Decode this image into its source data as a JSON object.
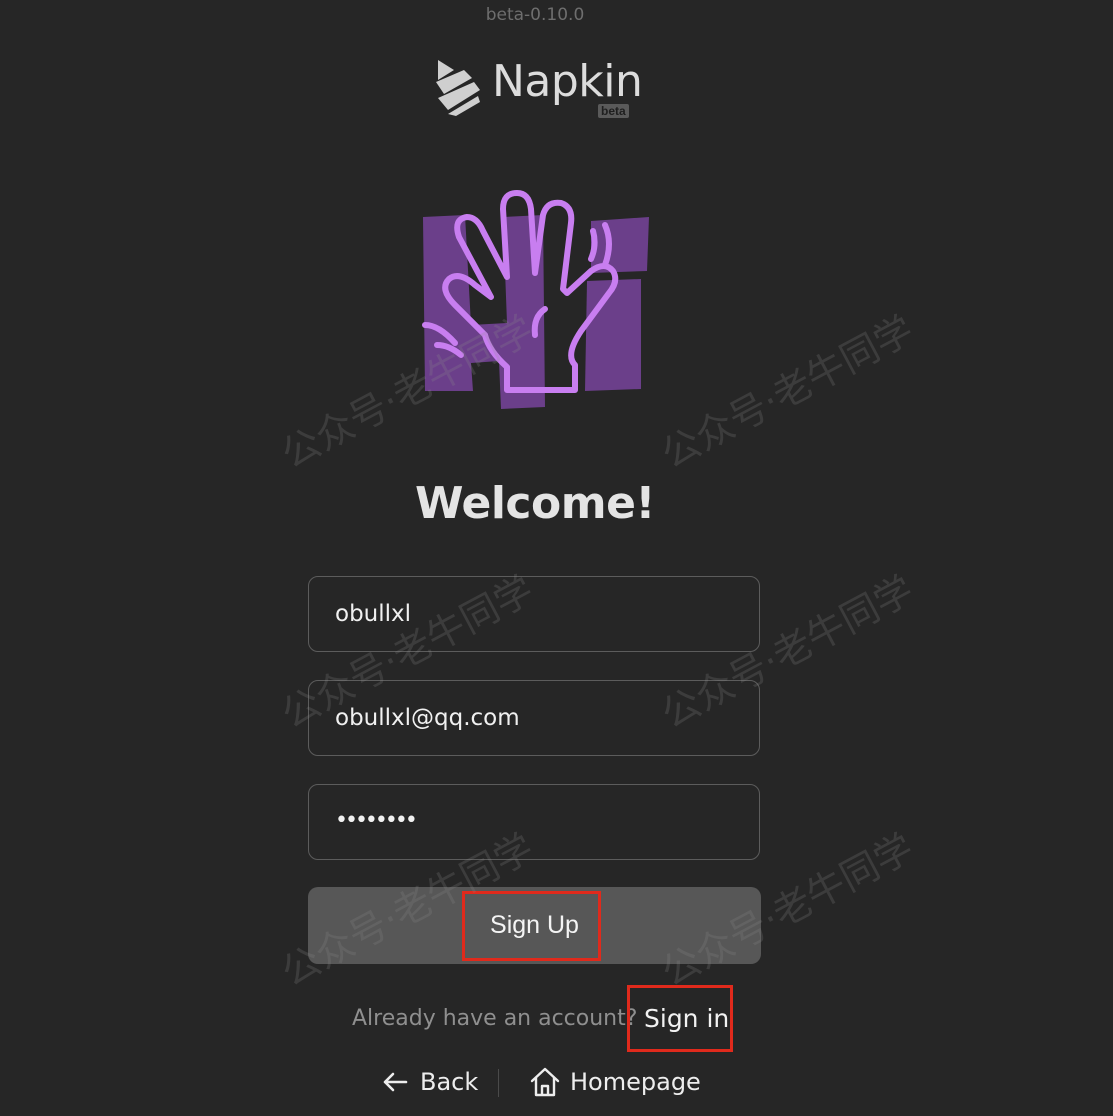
{
  "app": {
    "version": "beta-0.10.0",
    "brand_name": "Napkin",
    "brand_badge": "beta"
  },
  "welcome": {
    "title": "Welcome!",
    "hero_image": "waving-hand-hi-illustration"
  },
  "form": {
    "username_value": "obullxl",
    "email_value": "obullxl@qq.com",
    "password_mask": "••••••••",
    "signup_label": "Sign Up"
  },
  "footer": {
    "prompt": "Already have an account?",
    "signin_label": "Sign in",
    "back_label": "Back",
    "homepage_label": "Homepage"
  },
  "icons": {
    "back": "arrow-left-icon",
    "home": "home-icon",
    "logo": "napkin-logo-icon"
  },
  "watermark_text": "公众号·老牛同学",
  "colors": {
    "background": "#262626",
    "button": "#575757",
    "highlight": "#e02a1c",
    "hero_purple": "#6b3f8a",
    "hero_outline": "#c87ef0"
  }
}
